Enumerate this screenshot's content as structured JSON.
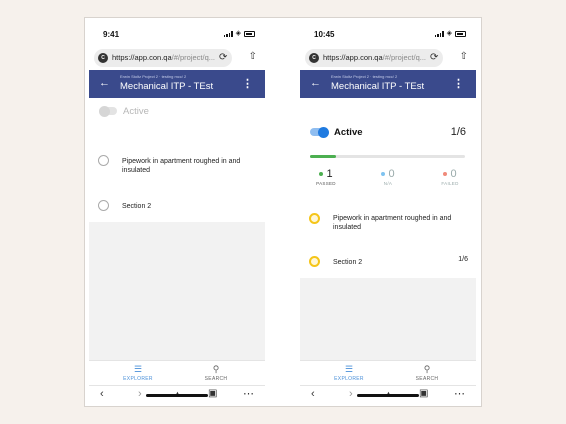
{
  "colors": {
    "appbar": "#3a4a8c",
    "accent_blue": "#1f7ae0",
    "progress_green": "#4caf50",
    "passed": "#4caf50",
    "na": "#7fc3f0",
    "failed": "#f08a7a",
    "pending_yellow": "#f5c518",
    "nav_active": "#4a90d9"
  },
  "left_phone": {
    "status_time": "9:41",
    "url_host": "https://app.con.qa",
    "url_path": "/#/project/q...",
    "breadcrumb": "Erwin Stoltz Project 2 · testing mcc/ 2",
    "title": "Mechanical ITP - TEst",
    "active_label": "Active",
    "items": [
      {
        "label": "Pipework in apartment roughed in and insulated"
      },
      {
        "label": "Section 2"
      }
    ],
    "nav": {
      "explorer": "EXPLORER",
      "search": "SEARCH"
    }
  },
  "right_phone": {
    "status_time": "10:45",
    "url_host": "https://app.con.qa",
    "url_path": "/#/project/q...",
    "breadcrumb": "Erwin Stoltz Project 2 · testing mcc/ 2",
    "title": "Mechanical ITP - TEst",
    "active_label": "Active",
    "count": "1/6",
    "progress_fraction": 0.17,
    "stats": [
      {
        "value": "1",
        "label": "PASSED"
      },
      {
        "value": "0",
        "label": "N/A"
      },
      {
        "value": "0",
        "label": "FAILED"
      }
    ],
    "items": [
      {
        "label": "Pipework in apartment roughed in and insulated",
        "count": ""
      },
      {
        "label": "Section 2",
        "count": "1/6"
      }
    ],
    "nav": {
      "explorer": "EXPLORER",
      "search": "SEARCH"
    }
  },
  "icons": {
    "back": "arrow-left-icon",
    "more": "more-vertical-icon",
    "explorer": "list-icon",
    "search": "search-icon",
    "reload": "reload-icon",
    "share": "share-icon"
  }
}
